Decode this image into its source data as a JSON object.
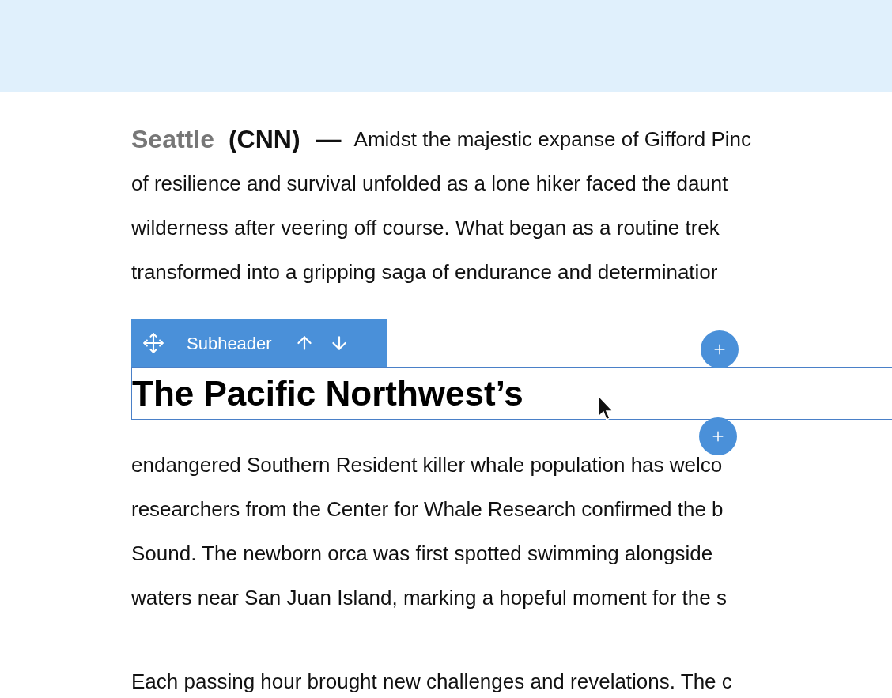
{
  "dateline": {
    "location": "Seattle",
    "source": "(CNN)",
    "dash": "—"
  },
  "intro_lines": [
    "Amidst the majestic expanse of Gifford Pinc",
    "of resilience and survival unfolded as a lone hiker faced the daunt",
    "wilderness after veering off course. What began as a routine trek",
    "transformed into a gripping saga of endurance and determinatior"
  ],
  "block_toolbar": {
    "label": "Subheader"
  },
  "subheader": {
    "text": "The Pacific Northwest’s",
    "selected": true
  },
  "body_lines": [
    "endangered Southern Resident killer whale population has welco",
    "researchers from the Center for Whale Research confirmed the b",
    "Sound. The newborn orca was first spotted swimming alongside",
    "waters near San Juan Island, marking a hopeful moment for the s"
  ],
  "last_line": "Each passing hour brought new challenges and revelations. The c"
}
